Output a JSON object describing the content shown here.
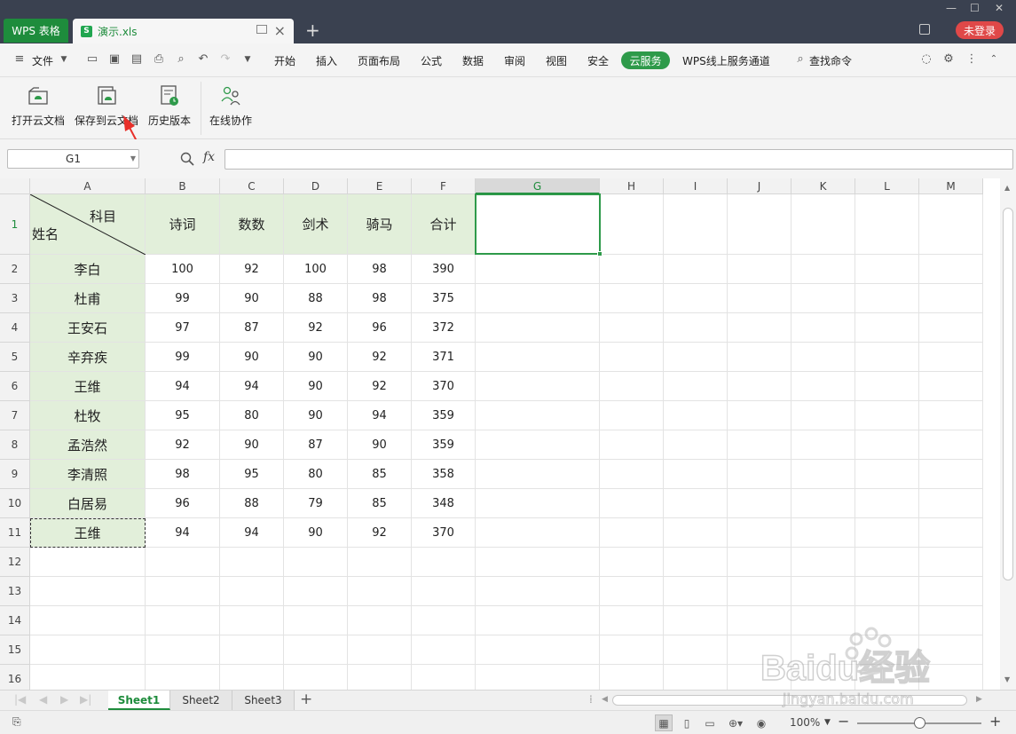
{
  "window": {
    "app_tab": "WPS 表格",
    "file_tab": "演示.xls",
    "login_button": "未登录",
    "window_controls": [
      "—",
      "☐",
      "✕"
    ]
  },
  "menu": {
    "file": "文件",
    "tabs": [
      "开始",
      "插入",
      "页面布局",
      "公式",
      "数据",
      "审阅",
      "视图",
      "安全",
      "云服务",
      "WPS线上服务通道"
    ],
    "active_tab": "云服务",
    "search": "查找命令"
  },
  "ribbon": {
    "buttons": [
      "打开云文档",
      "保存到云文档",
      "历史版本",
      "在线协作"
    ]
  },
  "formula_bar": {
    "name_box": "G1",
    "fx": "fx",
    "content": ""
  },
  "grid": {
    "columns": [
      "A",
      "B",
      "C",
      "D",
      "E",
      "F",
      "G",
      "H",
      "I",
      "J",
      "K",
      "L",
      "M"
    ],
    "selected_column": "G",
    "row_numbers": [
      "1",
      "2",
      "3",
      "4",
      "5",
      "6",
      "7",
      "8",
      "9",
      "10",
      "11",
      "12",
      "13",
      "14",
      "15",
      "16"
    ],
    "header_diag": {
      "top": "科目",
      "bottom": "姓名"
    },
    "headers": [
      "诗词",
      "数数",
      "剑术",
      "骑马",
      "合计"
    ],
    "rows": [
      {
        "name": "李白",
        "values": [
          "100",
          "92",
          "100",
          "98",
          "390"
        ]
      },
      {
        "name": "杜甫",
        "values": [
          "99",
          "90",
          "88",
          "98",
          "375"
        ]
      },
      {
        "name": "王安石",
        "values": [
          "97",
          "87",
          "92",
          "96",
          "372"
        ]
      },
      {
        "name": "辛弃疾",
        "values": [
          "99",
          "90",
          "90",
          "92",
          "371"
        ]
      },
      {
        "name": "王维",
        "values": [
          "94",
          "94",
          "90",
          "92",
          "370"
        ]
      },
      {
        "name": "杜牧",
        "values": [
          "95",
          "80",
          "90",
          "94",
          "359"
        ]
      },
      {
        "name": "孟浩然",
        "values": [
          "92",
          "90",
          "87",
          "90",
          "359"
        ]
      },
      {
        "name": "李清照",
        "values": [
          "98",
          "95",
          "80",
          "85",
          "358"
        ]
      },
      {
        "name": "白居易",
        "values": [
          "96",
          "88",
          "79",
          "85",
          "348"
        ]
      },
      {
        "name": "王维",
        "values": [
          "94",
          "94",
          "90",
          "92",
          "370"
        ]
      }
    ]
  },
  "sheets": {
    "tabs": [
      "Sheet1",
      "Sheet2",
      "Sheet3"
    ],
    "active": "Sheet1"
  },
  "status": {
    "zoom": "100%"
  },
  "watermark": {
    "brand": "Baidu经验",
    "url": "jingyan.baidu.com"
  },
  "colors": {
    "accent": "#2e9a4a",
    "header_fill": "#e2efda",
    "login": "#e04848",
    "titlebar": "#3a4150"
  }
}
